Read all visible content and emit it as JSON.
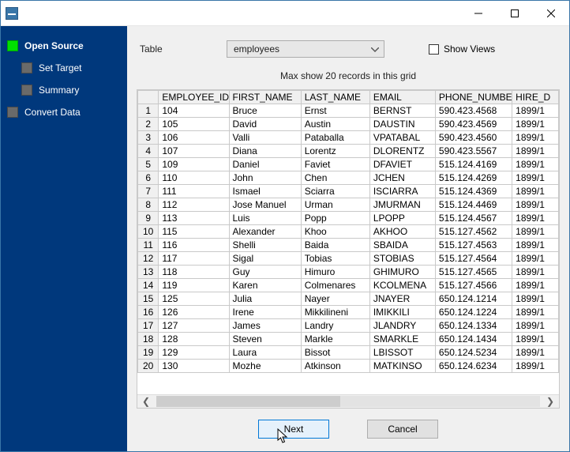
{
  "sidebar": {
    "items": [
      {
        "label": "Open Source"
      },
      {
        "label": "Set Target"
      },
      {
        "label": "Summary"
      },
      {
        "label": "Convert Data"
      }
    ]
  },
  "form": {
    "table_label": "Table",
    "table_selected": "employees",
    "show_views_label": "Show Views"
  },
  "note": "Max show 20 records in this grid",
  "columns": [
    "EMPLOYEE_ID",
    "FIRST_NAME",
    "LAST_NAME",
    "EMAIL",
    "PHONE_NUMBER",
    "HIRE_D"
  ],
  "rows": [
    {
      "n": "1",
      "id": "104",
      "fn": "Bruce",
      "ln": "Ernst",
      "em": "BERNST",
      "ph": "590.423.4568",
      "hd": "1899/1"
    },
    {
      "n": "2",
      "id": "105",
      "fn": "David",
      "ln": "Austin",
      "em": "DAUSTIN",
      "ph": "590.423.4569",
      "hd": "1899/1"
    },
    {
      "n": "3",
      "id": "106",
      "fn": "Valli",
      "ln": "Pataballa",
      "em": "VPATABAL",
      "ph": "590.423.4560",
      "hd": "1899/1"
    },
    {
      "n": "4",
      "id": "107",
      "fn": "Diana",
      "ln": "Lorentz",
      "em": "DLORENTZ",
      "ph": "590.423.5567",
      "hd": "1899/1"
    },
    {
      "n": "5",
      "id": "109",
      "fn": "Daniel",
      "ln": "Faviet",
      "em": "DFAVIET",
      "ph": "515.124.4169",
      "hd": "1899/1"
    },
    {
      "n": "6",
      "id": "110",
      "fn": "John",
      "ln": "Chen",
      "em": "JCHEN",
      "ph": "515.124.4269",
      "hd": "1899/1"
    },
    {
      "n": "7",
      "id": "111",
      "fn": "Ismael",
      "ln": "Sciarra",
      "em": "ISCIARRA",
      "ph": "515.124.4369",
      "hd": "1899/1"
    },
    {
      "n": "8",
      "id": "112",
      "fn": "Jose Manuel",
      "ln": "Urman",
      "em": "JMURMAN",
      "ph": "515.124.4469",
      "hd": "1899/1"
    },
    {
      "n": "9",
      "id": "113",
      "fn": "Luis",
      "ln": "Popp",
      "em": "LPOPP",
      "ph": "515.124.4567",
      "hd": "1899/1"
    },
    {
      "n": "10",
      "id": "115",
      "fn": "Alexander",
      "ln": "Khoo",
      "em": "AKHOO",
      "ph": "515.127.4562",
      "hd": "1899/1"
    },
    {
      "n": "11",
      "id": "116",
      "fn": "Shelli",
      "ln": "Baida",
      "em": "SBAIDA",
      "ph": "515.127.4563",
      "hd": "1899/1"
    },
    {
      "n": "12",
      "id": "117",
      "fn": "Sigal",
      "ln": "Tobias",
      "em": "STOBIAS",
      "ph": "515.127.4564",
      "hd": "1899/1"
    },
    {
      "n": "13",
      "id": "118",
      "fn": "Guy",
      "ln": "Himuro",
      "em": "GHIMURO",
      "ph": "515.127.4565",
      "hd": "1899/1"
    },
    {
      "n": "14",
      "id": "119",
      "fn": "Karen",
      "ln": "Colmenares",
      "em": "KCOLMENA",
      "ph": "515.127.4566",
      "hd": "1899/1"
    },
    {
      "n": "15",
      "id": "125",
      "fn": "Julia",
      "ln": "Nayer",
      "em": "JNAYER",
      "ph": "650.124.1214",
      "hd": "1899/1"
    },
    {
      "n": "16",
      "id": "126",
      "fn": "Irene",
      "ln": "Mikkilineni",
      "em": "IMIKKILI",
      "ph": "650.124.1224",
      "hd": "1899/1"
    },
    {
      "n": "17",
      "id": "127",
      "fn": "James",
      "ln": "Landry",
      "em": "JLANDRY",
      "ph": "650.124.1334",
      "hd": "1899/1"
    },
    {
      "n": "18",
      "id": "128",
      "fn": "Steven",
      "ln": "Markle",
      "em": "SMARKLE",
      "ph": "650.124.1434",
      "hd": "1899/1"
    },
    {
      "n": "19",
      "id": "129",
      "fn": "Laura",
      "ln": "Bissot",
      "em": "LBISSOT",
      "ph": "650.124.5234",
      "hd": "1899/1"
    },
    {
      "n": "20",
      "id": "130",
      "fn": "Mozhe",
      "ln": "Atkinson",
      "em": "MATKINSO",
      "ph": "650.124.6234",
      "hd": "1899/1"
    }
  ],
  "buttons": {
    "next": "Next",
    "cancel": "Cancel"
  }
}
